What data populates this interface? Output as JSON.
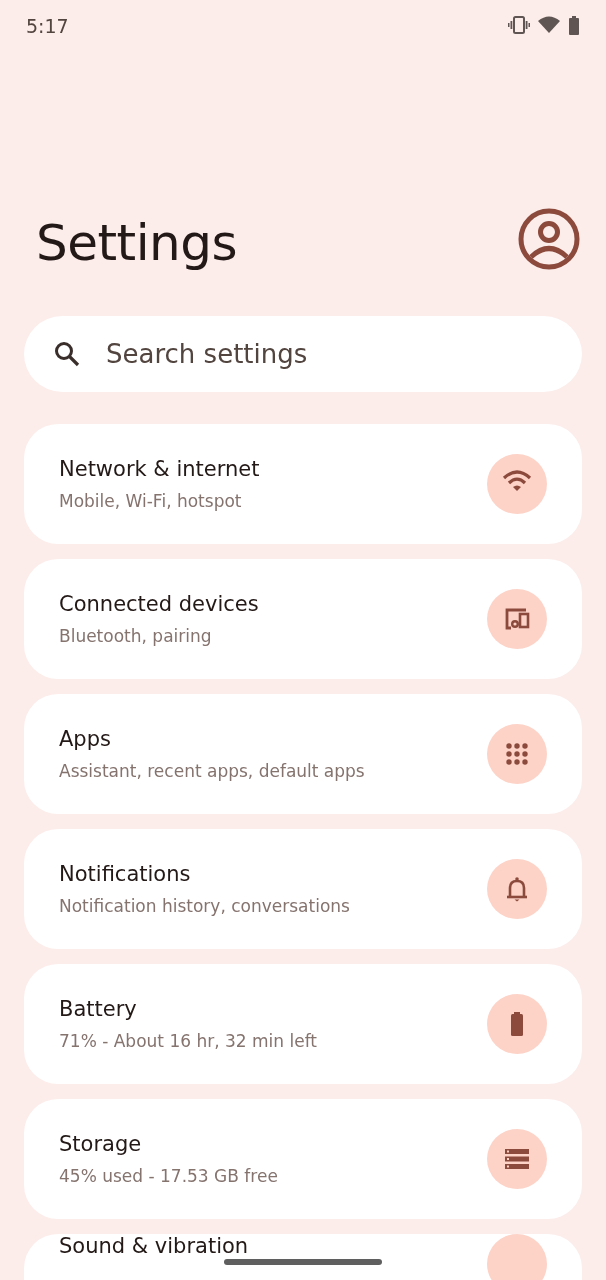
{
  "status_bar": {
    "time": "5:17"
  },
  "title": "Settings",
  "search": {
    "placeholder": "Search settings"
  },
  "items": [
    {
      "title": "Network & internet",
      "subtitle": "Mobile, Wi-Fi, hotspot"
    },
    {
      "title": "Connected devices",
      "subtitle": "Bluetooth, pairing"
    },
    {
      "title": "Apps",
      "subtitle": "Assistant, recent apps, default apps"
    },
    {
      "title": "Notifications",
      "subtitle": "Notification history, conversations"
    },
    {
      "title": "Battery",
      "subtitle": "71% - About 16 hr, 32 min left"
    },
    {
      "title": "Storage",
      "subtitle": "45% used - 17.53 GB free"
    },
    {
      "title": "Sound & vibration"
    }
  ]
}
